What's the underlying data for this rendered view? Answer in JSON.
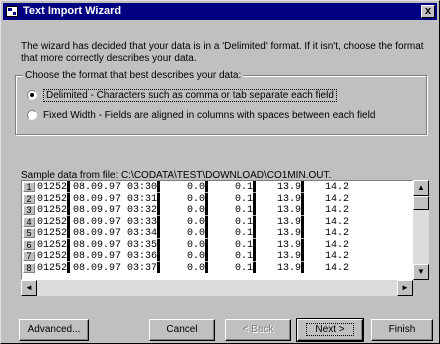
{
  "window": {
    "title": "Text Import Wizard",
    "close_glyph": "x"
  },
  "intro_text": "The wizard has decided that your data is in a 'Delimited' format.  If it isn't, choose the format that more correctly describes your data.",
  "format_group": {
    "label": "Choose the format that best describes your data:",
    "options": [
      {
        "label": "Delimited - Characters such as comma or tab separate each field",
        "checked": true
      },
      {
        "label": "Fixed Width - Fields are aligned in columns with spaces between each field",
        "checked": false
      }
    ]
  },
  "sample": {
    "label": "Sample data from file: C:\\CODATA\\TEST\\DOWNLOAD\\CO1MIN.OUT.",
    "rows": [
      {
        "num": "1",
        "text": "01252▌08.09.97 03:30▌    0.0▌    0.1▌   13.9▌   14.2"
      },
      {
        "num": "2",
        "text": "01252▌08.09.97 03:31▌    0.0▌    0.1▌   13.9▌   14.2"
      },
      {
        "num": "3",
        "text": "01252▌08.09.97 03:32▌    0.0▌    0.1▌   13.9▌   14.2"
      },
      {
        "num": "4",
        "text": "01252▌08.09.97 03:33▌    0.0▌    0.1▌   13.9▌   14.2"
      },
      {
        "num": "5",
        "text": "01252▌08.09.97 03:34▌    0.0▌    0.1▌   13.9▌   14.2"
      },
      {
        "num": "6",
        "text": "01252▌08.09.97 03:35▌    0.0▌    0.1▌   13.9▌   14.2"
      },
      {
        "num": "7",
        "text": "01252▌08.09.97 03:36▌    0.0▌    0.1▌   13.9▌   14.2"
      },
      {
        "num": "8",
        "text": "01252▌08.09.97 03:37▌    0.0▌    0.1▌   13.9▌   14.2"
      }
    ]
  },
  "buttons": {
    "advanced": "Advanced...",
    "cancel": "Cancel",
    "back": "< Back",
    "next": "Next >",
    "finish": "Finish"
  },
  "icons": {
    "scroll_up": "▲",
    "scroll_down": "▼",
    "scroll_left": "◄",
    "scroll_right": "►"
  }
}
